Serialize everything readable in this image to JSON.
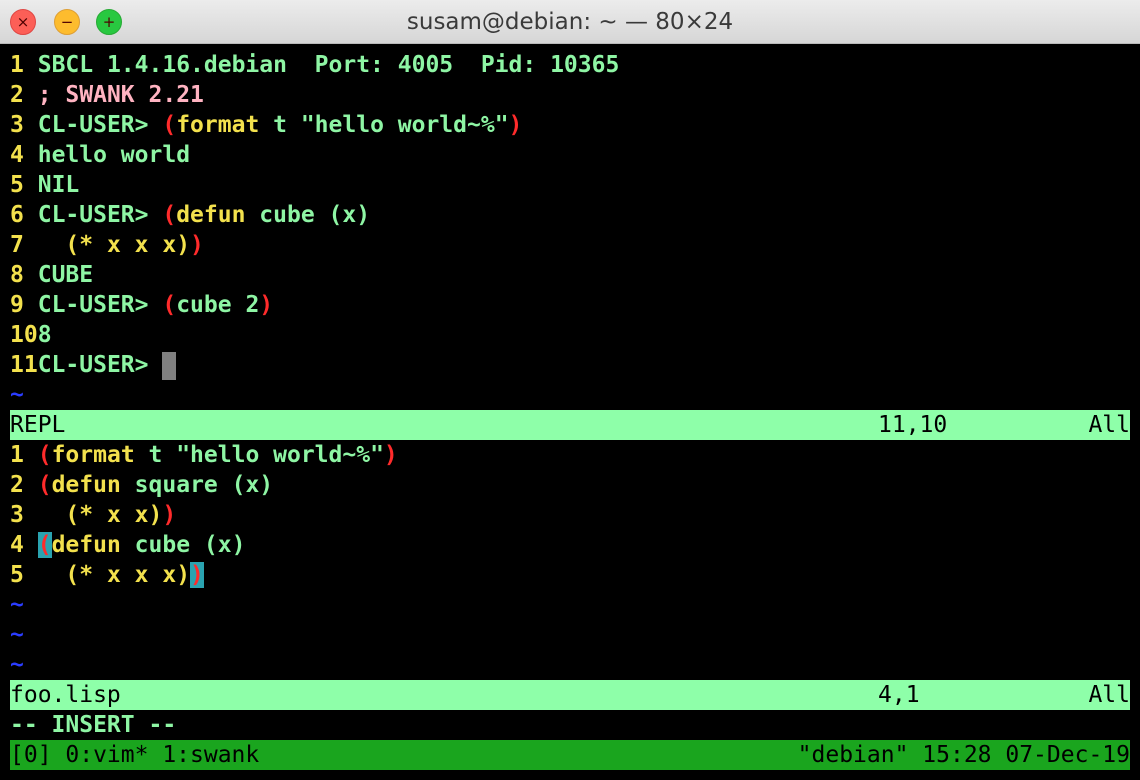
{
  "window": {
    "title": "susam@debian: ~ — 80×24",
    "buttons": {
      "close": "×",
      "minimize": "−",
      "zoom": "+"
    }
  },
  "repl": {
    "lines": [
      {
        "num": "1",
        "text": "SBCL 1.4.16.debian  Port: 4005  Pid: 10365"
      },
      {
        "num": "2",
        "text": "; SWANK 2.21"
      },
      {
        "num": "3",
        "prompt": "CL-USER> ",
        "open": "(",
        "kw": "format",
        "rest": " t \"hello world~%\"",
        "close": ")"
      },
      {
        "num": "4",
        "text": "hello world"
      },
      {
        "num": "5",
        "text": "NIL"
      },
      {
        "num": "6",
        "prompt": "CL-USER> ",
        "open": "(",
        "kw": "defun",
        "rest": " cube (x)"
      },
      {
        "num": "7",
        "indent": "  ",
        "body": "(* x x x)",
        "close": ")"
      },
      {
        "num": "8",
        "text": "CUBE"
      },
      {
        "num": "9",
        "prompt": "CL-USER> ",
        "open": "(",
        "rest": "cube 2",
        "close": ")"
      },
      {
        "num": "10",
        "text": "8"
      },
      {
        "num": "11",
        "prompt": "CL-USER> "
      }
    ],
    "tilde": "~",
    "status": {
      "name": "REPL",
      "position": "11,10",
      "percent": "All"
    }
  },
  "file": {
    "lines": [
      {
        "num": "1",
        "open": "(",
        "kw": "format",
        "rest": " t \"hello world~%\"",
        "close": ")"
      },
      {
        "num": "2",
        "open": "(",
        "kw": "defun",
        "rest": " square (x)"
      },
      {
        "num": "3",
        "indent": "  ",
        "body": "(* x x)",
        "close": ")"
      },
      {
        "num": "4",
        "open": "(",
        "kw": "defun",
        "rest": " cube (x)"
      },
      {
        "num": "5",
        "indent": "  ",
        "body": "(* x x x)",
        "close": ")"
      }
    ],
    "tilde": "~",
    "status": {
      "name": "foo.lisp",
      "position": "4,1",
      "percent": "All"
    }
  },
  "mode": "-- INSERT --",
  "tmux": {
    "left": "[0] 0:vim* 1:swank",
    "right": "\"debian\" 15:28 07-Dec-19"
  },
  "colors": {
    "status_bar": "#8effa9",
    "tmux_bar": "#1aa51e",
    "line_number": "#f3e14d",
    "text": "#8ef5a4",
    "paren": "#ff2b2b",
    "tilde": "#2a3cff",
    "match_highlight": "#2aa3b0"
  }
}
